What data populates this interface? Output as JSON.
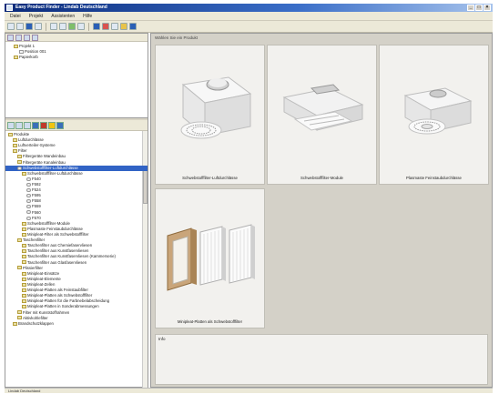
{
  "window": {
    "title": "Easy Product Finder - Lindab Deutschland"
  },
  "menu": [
    "Datei",
    "Projekt",
    "Assistenten",
    "Hilfe"
  ],
  "project_tree": [
    {
      "label": "Projekt 1",
      "depth": 1,
      "kind": "folder"
    },
    {
      "label": "Position 001",
      "depth": 2,
      "kind": "file"
    },
    {
      "label": "Papierkorb",
      "depth": 1,
      "kind": "folder"
    }
  ],
  "product_tree": [
    {
      "label": "Produkte",
      "depth": 0,
      "kind": "folder"
    },
    {
      "label": "Luftdurchlässe",
      "depth": 1,
      "kind": "folder"
    },
    {
      "label": "Luftverteiler-Systeme",
      "depth": 1,
      "kind": "folder"
    },
    {
      "label": "Filter",
      "depth": 1,
      "kind": "folder"
    },
    {
      "label": "Filtergeräte Wandeinbau",
      "depth": 2,
      "kind": "folder"
    },
    {
      "label": "Filtergeräte Kanaleinbau",
      "depth": 2,
      "kind": "folder"
    },
    {
      "label": "Schwebstofffilter-Luftdurchlässe",
      "depth": 2,
      "kind": "item",
      "selected": true
    },
    {
      "label": "Schwebstofffilter-Luftdurchlässe",
      "depth": 3,
      "kind": "folder"
    },
    {
      "label": "F540",
      "depth": 4,
      "kind": "item"
    },
    {
      "label": "F592",
      "depth": 4,
      "kind": "item"
    },
    {
      "label": "F524",
      "depth": 4,
      "kind": "item"
    },
    {
      "label": "F595",
      "depth": 4,
      "kind": "item"
    },
    {
      "label": "F558",
      "depth": 4,
      "kind": "item"
    },
    {
      "label": "F559",
      "depth": 4,
      "kind": "item"
    },
    {
      "label": "F560",
      "depth": 4,
      "kind": "item"
    },
    {
      "label": "F570",
      "depth": 4,
      "kind": "item"
    },
    {
      "label": "Schwebstofffilter-Module",
      "depth": 3,
      "kind": "folder"
    },
    {
      "label": "Plasmaste Feinstaubdurchlässe",
      "depth": 3,
      "kind": "folder"
    },
    {
      "label": "Minipleat-Filter als Schwebstofffilter",
      "depth": 3,
      "kind": "folder"
    },
    {
      "label": "Taschenfilter",
      "depth": 2,
      "kind": "folder"
    },
    {
      "label": "Taschenfilter aus Chemiefaservliesen",
      "depth": 3,
      "kind": "folder"
    },
    {
      "label": "Taschenfilter aus Kunstfaservliesen",
      "depth": 3,
      "kind": "folder"
    },
    {
      "label": "Taschenfilter aus Kunstfaservliesen (Kammerserie)",
      "depth": 3,
      "kind": "folder"
    },
    {
      "label": "Taschenfilter aus Glasfaservliesen",
      "depth": 3,
      "kind": "folder"
    },
    {
      "label": "Plissierfilter",
      "depth": 2,
      "kind": "folder"
    },
    {
      "label": "Minipleat-Einsätze",
      "depth": 3,
      "kind": "folder"
    },
    {
      "label": "Minipleat-Elemente",
      "depth": 3,
      "kind": "folder"
    },
    {
      "label": "Minipleat-Zellen",
      "depth": 3,
      "kind": "folder"
    },
    {
      "label": "Minipleat-Platten als Feinstaubfilter",
      "depth": 3,
      "kind": "folder"
    },
    {
      "label": "Minipleat-Platten als Schwebstofffilter",
      "depth": 3,
      "kind": "folder"
    },
    {
      "label": "Minipleat-Platten für die Farbnebelabscheidung",
      "depth": 3,
      "kind": "folder"
    },
    {
      "label": "Minipleat-Platten in Sonderabmessungen",
      "depth": 3,
      "kind": "folder"
    },
    {
      "label": "Filter mit Kunststoffrahmen",
      "depth": 2,
      "kind": "folder"
    },
    {
      "label": "Aktivkohlefilter",
      "depth": 2,
      "kind": "folder"
    },
    {
      "label": "Brandschutzklappen",
      "depth": 1,
      "kind": "folder"
    }
  ],
  "main": {
    "header": "Wählen Sie ein Produkt",
    "cards": [
      {
        "label": "Schwebstofffilter-Luftdurchlässe",
        "icon": "diffuser-box-icon"
      },
      {
        "label": "Schwebstofffilter-Module",
        "icon": "filter-module-icon"
      },
      {
        "label": "Plasmaste Feinstaubdurchlässe",
        "icon": "diffuser-round-icon"
      },
      {
        "label": "Minipleat-Platten als Schwebstofffilter",
        "icon": "minipleat-panels-icon"
      }
    ],
    "info_label": "Info"
  },
  "status": {
    "text": "Lindab Deutschland"
  },
  "colors": {
    "selection": "#3163c5",
    "title_start": "#0a2a7a",
    "title_end": "#a8c4ec"
  }
}
